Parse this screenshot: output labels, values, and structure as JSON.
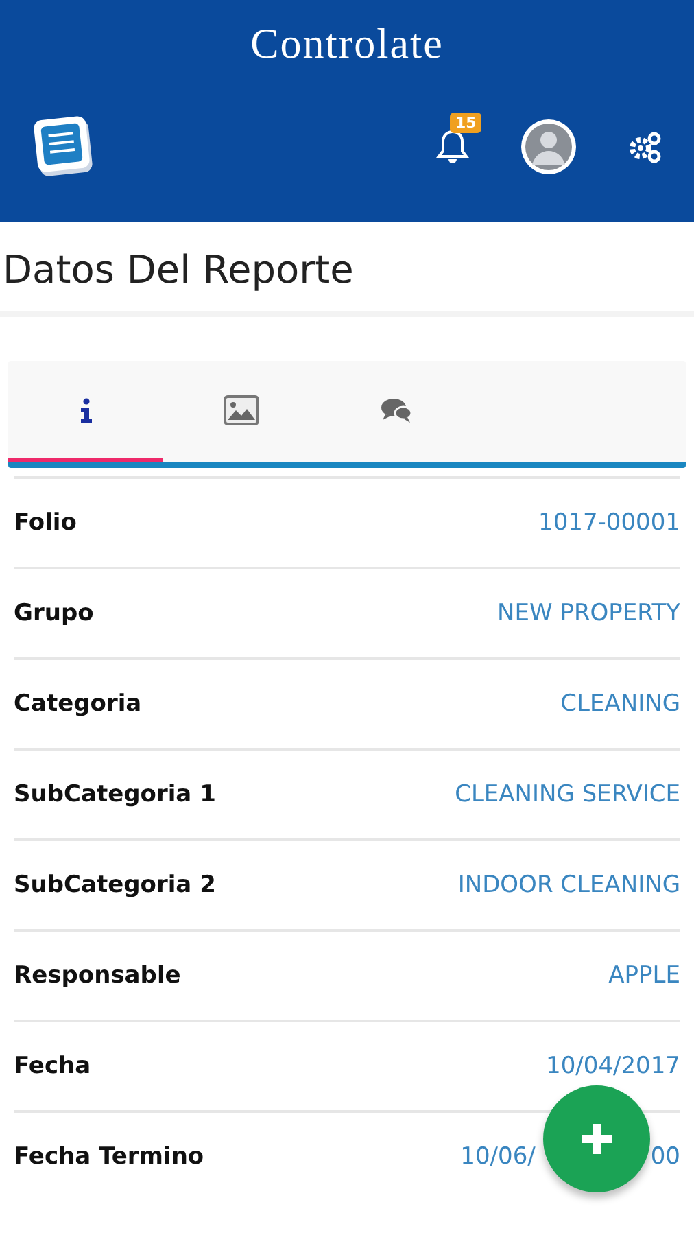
{
  "app_bar": {
    "title": "Controlate",
    "notifications": {
      "badge": "15"
    }
  },
  "page_title": "Datos Del Reporte",
  "tabs": [
    {
      "kind": "info",
      "selected": true
    },
    {
      "kind": "image",
      "selected": false
    },
    {
      "kind": "comments",
      "selected": false
    }
  ],
  "fields": [
    {
      "label": "Folio",
      "value": "1017-00001"
    },
    {
      "label": "Grupo",
      "value": "NEW PROPERTY"
    },
    {
      "label": "Categoria",
      "value": "CLEANING"
    },
    {
      "label": "SubCategoria 1",
      "value": "CLEANING SERVICE"
    },
    {
      "label": "SubCategoria 2",
      "value": "INDOOR CLEANING"
    },
    {
      "label": "Responsable",
      "value": "APPLE"
    },
    {
      "label": "Fecha",
      "value": "10/04/2017"
    },
    {
      "label": "Fecha Termino",
      "value_parts": [
        "10/06/",
        "00"
      ]
    }
  ]
}
